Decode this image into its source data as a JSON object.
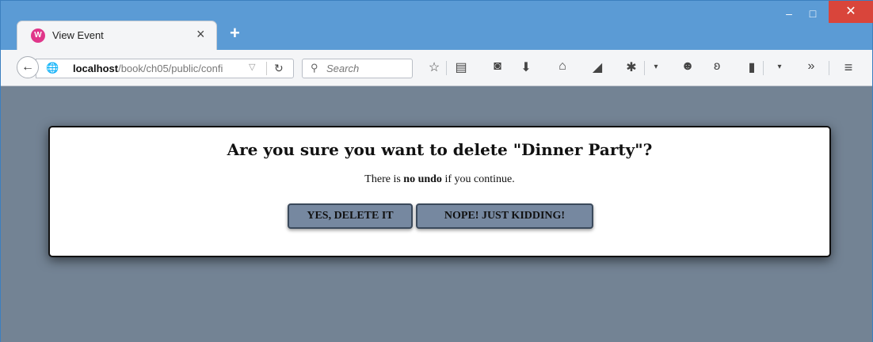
{
  "browser": {
    "tab": {
      "title": "View Event",
      "close_glyph": "×",
      "favicon_icon": "wolf-icon"
    },
    "new_tab_glyph": "+",
    "window_controls": {
      "minimize": "–",
      "maximize": "□",
      "close": "✕"
    },
    "address": {
      "host": "localhost",
      "path": "/book/ch05/public/confi"
    },
    "search": {
      "placeholder": "Search"
    },
    "toolbar_icons": [
      "star-icon",
      "reading-list-icon",
      "pocket-icon",
      "download-icon",
      "home-icon",
      "send-icon",
      "extension-icon",
      "chat-icon",
      "addon-icon",
      "clipboard-icon",
      "overflow-icon",
      "menu-icon"
    ]
  },
  "dialog": {
    "title": "Are you sure you want to delete \"Dinner Party\"?",
    "message_prefix": "There is ",
    "message_bold": "no undo",
    "message_suffix": " if you continue.",
    "confirm_label": "YES, DELETE IT",
    "cancel_label": "NOPE! JUST KIDDING!"
  },
  "colors": {
    "page_background": "#738394",
    "button_background": "#7688a0",
    "window_frame": "#5b9bd5",
    "close_button": "#d9453b"
  }
}
